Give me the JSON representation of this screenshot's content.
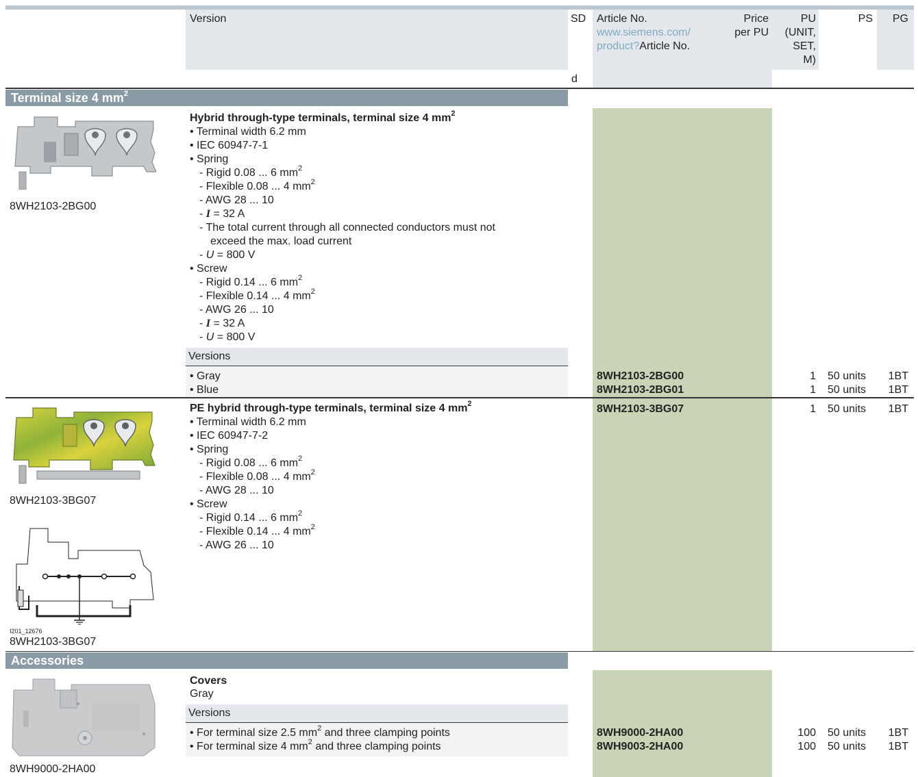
{
  "header": {
    "version": "Version",
    "sd": "SD",
    "sd_sub": "d",
    "article_no": "Article No.",
    "article_link1": "www.siemens.com/",
    "article_link2": "product?",
    "article_link_suffix": "Article No.",
    "price1": "Price",
    "price2": "per PU",
    "pu": [
      "PU",
      "(UNIT,",
      "SET,",
      "M)"
    ],
    "ps": "PS",
    "pg": "PG"
  },
  "section1": {
    "title": "Terminal size 4 mm",
    "title_sup": "2"
  },
  "product1": {
    "image_caption": "8WH2103-2BG00",
    "heading": "Hybrid through-type terminals, terminal size 4 mm",
    "heading_sup": "2",
    "bullets": {
      "width": "• Terminal width 6.2 mm",
      "iec": "• IEC 60947-7-1",
      "spring": "• Spring",
      "spring_rigid": "- Rigid 0.08 ... 6 mm",
      "spring_flex": "- Flexible 0.08 ... 4 mm",
      "spring_awg": "- AWG 28 ... 10",
      "spring_i": "= 32 A",
      "spring_note1": "- The total current through all connected conductors must not",
      "spring_note2": "exceed the max. load current",
      "spring_u": "= 800 V",
      "screw": "• Screw",
      "screw_rigid": "- Rigid 0.14 ... 6 mm",
      "screw_flex": "- Flexible 0.14 ... 4 mm",
      "screw_awg": "- AWG 26 ... 10",
      "screw_i": "= 32 A",
      "screw_u": "= 800 V",
      "sym_i": "I",
      "sym_u": "U",
      "sup2": "2"
    },
    "versions_label": "Versions",
    "rows": [
      {
        "version": "• Gray",
        "article": "8WH2103-2BG00",
        "pu": "1",
        "ps": "50 units",
        "pg": "1BT"
      },
      {
        "version": "• Blue",
        "article": "8WH2103-2BG01",
        "pu": "1",
        "ps": "50 units",
        "pg": "1BT"
      }
    ]
  },
  "product2": {
    "image_caption": "8WH2103-3BG07",
    "diagram_code": "I201_12676",
    "diagram_caption": "8WH2103-3BG07",
    "heading": "PE hybrid through-type terminals, terminal size 4 mm",
    "heading_sup": "2",
    "article": "8WH2103-3BG07",
    "pu": "1",
    "ps": "50 units",
    "pg": "1BT",
    "bullets": {
      "width": "• Terminal width 6.2 mm",
      "iec": "• IEC 60947-7-2",
      "spring": "• Spring",
      "spring_rigid": "- Rigid 0.08 ... 6 mm",
      "spring_flex": "- Flexible 0.08 ... 4 mm",
      "spring_awg": "- AWG 28 ... 10",
      "screw": "• Screw",
      "screw_rigid": "- Rigid 0.14 ... 6 mm",
      "screw_flex": "- Flexible 0.14 ... 4 mm",
      "screw_awg": "- AWG 26 ... 10",
      "sup2": "2"
    }
  },
  "section2": {
    "title": "Accessories"
  },
  "product3": {
    "image_caption": "8WH9000-2HA00",
    "heading": "Covers",
    "subheading": "Gray",
    "versions_label": "Versions",
    "rows": [
      {
        "version_pre": "• For terminal size 2.5 mm",
        "version_post": " and three clamping points",
        "article": "8WH9000-2HA00",
        "pu": "100",
        "ps": "50 units",
        "pg": "1BT"
      },
      {
        "version_pre": "• For terminal size 4 mm",
        "version_post": " and three clamping points",
        "article": "8WH9003-2HA00",
        "pu": "100",
        "ps": "50 units",
        "pg": "1BT"
      }
    ],
    "sup2": "2"
  },
  "colors": {
    "header_bg": "#e4e8ec",
    "article_col": "#c9d3b6",
    "section_bar": "#8a9ba6",
    "link": "#7fa9c4"
  }
}
